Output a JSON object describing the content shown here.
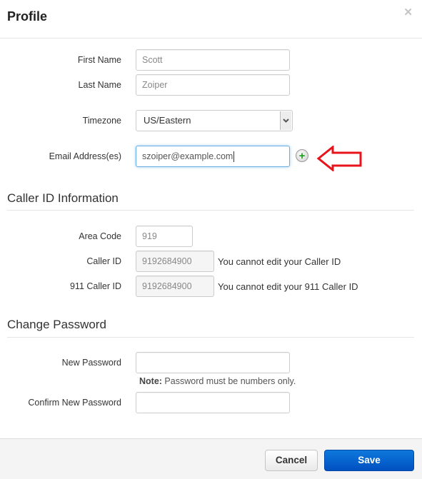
{
  "header": {
    "title": "Profile",
    "close_icon": "close-icon"
  },
  "profile": {
    "first_name": {
      "label": "First Name",
      "value": "Scott"
    },
    "last_name": {
      "label": "Last Name",
      "value": "Zoiper"
    },
    "timezone": {
      "label": "Timezone",
      "value": "US/Eastern"
    },
    "email": {
      "label": "Email Address(es)",
      "value": "szoiper@example.com",
      "add_icon": "plus-circle-icon"
    }
  },
  "annotation": {
    "arrow_icon": "red-arrow-left-icon",
    "color": "#e8141c"
  },
  "caller_id": {
    "section_title": "Caller ID Information",
    "area_code": {
      "label": "Area Code",
      "value": "919"
    },
    "caller_id": {
      "label": "Caller ID",
      "value": "9192684900",
      "help": "You cannot edit your Caller ID"
    },
    "caller_id_911": {
      "label": "911 Caller ID",
      "value": "9192684900",
      "help": "You cannot edit your 911 Caller ID"
    }
  },
  "password": {
    "section_title": "Change Password",
    "new_password": {
      "label": "New Password",
      "value": ""
    },
    "note_label": "Note:",
    "note_text": " Password must be numbers only.",
    "confirm_password": {
      "label": "Confirm New Password",
      "value": ""
    }
  },
  "footer": {
    "cancel_label": "Cancel",
    "save_label": "Save",
    "save_color": "#0a63d1"
  }
}
